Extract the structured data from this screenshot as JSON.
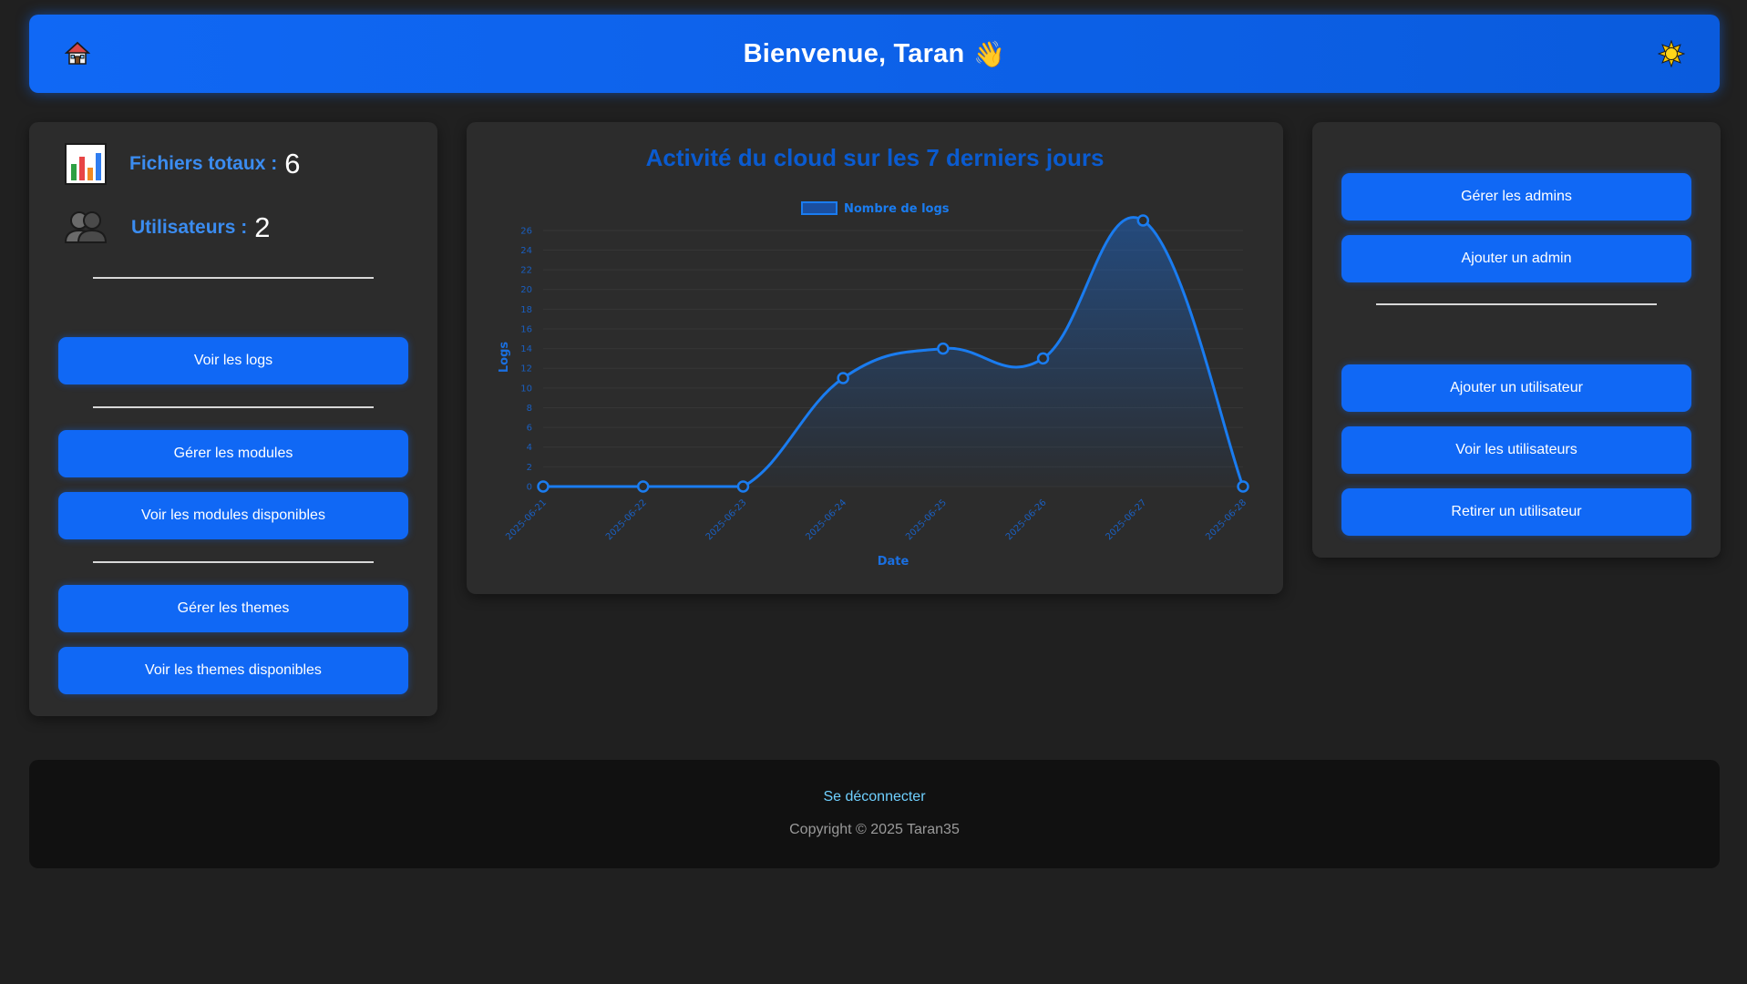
{
  "header": {
    "title": "Bienvenue, Taran",
    "wave_emoji": "👋",
    "home_icon": "home-icon",
    "theme_icon": "sun-icon",
    "gradient_start": "#1068f5",
    "gradient_end": "#0a5bdd"
  },
  "stats": {
    "files_label": "Fichiers totaux :",
    "files_value": "6",
    "users_label": "Utilisateurs :",
    "users_value": "2"
  },
  "left_buttons": {
    "view_logs": "Voir les logs",
    "manage_modules": "Gérer les modules",
    "view_modules": "Voir les modules disponibles",
    "manage_themes": "Gérer les themes",
    "view_themes": "Voir les themes disponibles"
  },
  "right_buttons": {
    "manage_admins": "Gérer les admins",
    "add_admin": "Ajouter un admin",
    "add_user": "Ajouter un utilisateur",
    "view_users": "Voir les utilisateurs",
    "remove_user": "Retirer un utilisateur"
  },
  "footer": {
    "logout": "Se déconnecter",
    "copyright": "Copyright © 2025 Taran35"
  },
  "colors": {
    "accent": "#1068f5",
    "background": "#202020",
    "card": "#2c2c2c",
    "chart_line": "#1a7cf0"
  },
  "chart_data": {
    "type": "line",
    "title": "Activité du cloud sur les 7 derniers jours",
    "legend": "Nombre de logs",
    "legend_position": "top",
    "xlabel": "Date",
    "ylabel": "Logs",
    "x": [
      "2025-06-21",
      "2025-06-22",
      "2025-06-23",
      "2025-06-24",
      "2025-06-25",
      "2025-06-26",
      "2025-06-27",
      "2025-06-28"
    ],
    "series": [
      {
        "name": "Nombre de logs",
        "values": [
          0,
          0,
          0,
          11,
          14,
          13,
          27,
          0
        ]
      }
    ],
    "ylim": [
      0,
      27
    ],
    "yticks": [
      0,
      2,
      4,
      6,
      8,
      10,
      12,
      14,
      16,
      18,
      20,
      22,
      24,
      26
    ],
    "grid": true,
    "fill": true
  }
}
